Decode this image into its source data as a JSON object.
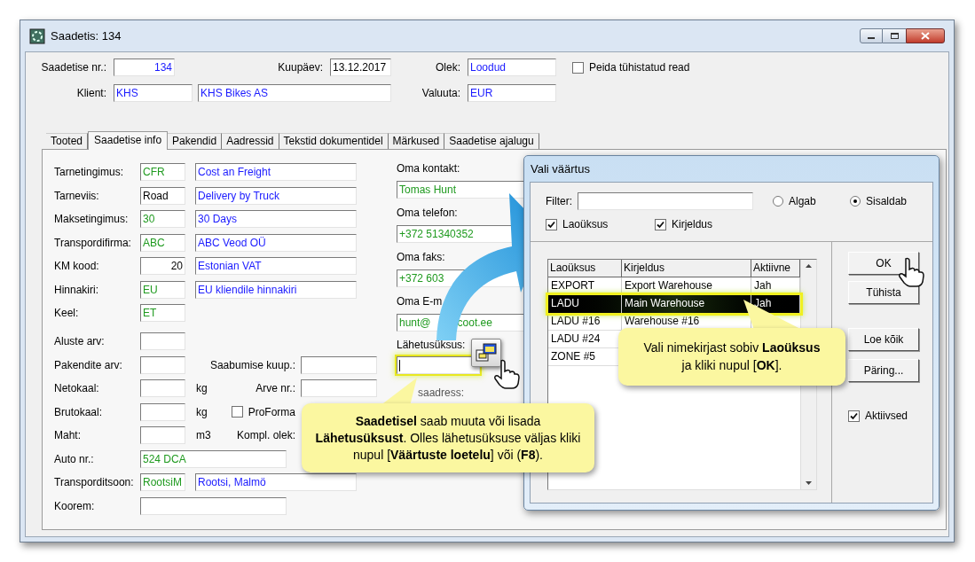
{
  "window": {
    "title": "Saadetis: 134"
  },
  "header": {
    "number_label": "Saadetise nr.:",
    "number": "134",
    "date_label": "Kuupäev:",
    "date": "13.12.2017",
    "status_label": "Olek:",
    "status": "Loodud",
    "hide_cancelled": {
      "label": "Peida tühistatud read",
      "checked": false
    },
    "client_label": "Klient:",
    "client_code": "KHS",
    "client_name": "KHS Bikes AS",
    "currency_label": "Valuuta:",
    "currency": "EUR"
  },
  "tabs": [
    {
      "label": "Tooted",
      "selected": false
    },
    {
      "label": "Saadetise info",
      "selected": true
    },
    {
      "label": "Pakendid",
      "selected": false
    },
    {
      "label": "Aadressid",
      "selected": false
    },
    {
      "label": "Tekstid dokumentidel",
      "selected": false
    },
    {
      "label": "Märkused",
      "selected": false
    },
    {
      "label": "Saadetise ajalugu",
      "selected": false
    }
  ],
  "terms": [
    {
      "label": "Tarnetingimus:",
      "code": {
        "text": "CFR",
        "kind": "code"
      },
      "name": {
        "text": "Cost an Freight",
        "kind": "name"
      }
    },
    {
      "label": "Tarneviis:",
      "code": {
        "text": "Road",
        "kind": "plain"
      },
      "name": {
        "text": "Delivery by Truck",
        "kind": "name"
      }
    },
    {
      "label": "Maksetingimus:",
      "code": {
        "text": "30",
        "kind": "code"
      },
      "name": {
        "text": "30 Days",
        "kind": "name"
      }
    },
    {
      "label": "Transpordifirma:",
      "code": {
        "text": "ABC",
        "kind": "code"
      },
      "name": {
        "text": "ABC Veod OÜ",
        "kind": "name"
      }
    },
    {
      "label": "KM kood:",
      "code": {
        "text": "20",
        "kind": "number"
      },
      "name": {
        "text": "Estonian VAT",
        "kind": "name"
      }
    },
    {
      "label": "Hinnakiri:",
      "code": {
        "text": "EU",
        "kind": "code"
      },
      "name": {
        "text": "EU kliendile hinnakiri",
        "kind": "name"
      }
    },
    {
      "label": "Keel:",
      "code": {
        "text": "ET",
        "kind": "code"
      }
    }
  ],
  "details": [
    {
      "label": "Aluste arv:",
      "kind": "short"
    },
    {
      "label": "Pakendite arv:",
      "kind": "short",
      "extra": {
        "kind": "field",
        "label": "Saabumise kuup.:"
      }
    },
    {
      "label": "Netokaal:",
      "kind": "short",
      "unit": "kg",
      "extra": {
        "kind": "field",
        "label": "Arve nr.:"
      }
    },
    {
      "label": "Brutokaal:",
      "kind": "short",
      "unit": "kg",
      "extra": {
        "kind": "checkbox",
        "label": "ProForma",
        "checked": false
      }
    },
    {
      "label": "Maht:",
      "kind": "short",
      "unit": "m3",
      "extra": {
        "kind": "label",
        "label": "Kompl. olek:"
      }
    },
    {
      "label": "Auto nr.:",
      "kind": "wide",
      "value": {
        "text": "524 DCA",
        "kind": "code"
      }
    },
    {
      "label": "Transporditsoon:",
      "kind": "pair",
      "value": {
        "text": "RootsiM",
        "kind": "code"
      },
      "name": {
        "text": "Rootsi, Malmö",
        "kind": "name"
      }
    },
    {
      "label": "Koorem:",
      "kind": "wide"
    }
  ],
  "contacts": [
    {
      "label": "Oma kontakt:",
      "value": "Tomas Hunt"
    },
    {
      "label": "Oma telefon:",
      "value": "+372 51340352"
    },
    {
      "label": "Oma faks:",
      "value": "+372 603"
    },
    {
      "label": "Oma E-m",
      "value": "hunt@",
      "value_after": "coot.ee"
    }
  ],
  "dispatch_unit": {
    "label": "Lähetusüksus:",
    "highlighted": true
  },
  "dispatch_address_label": "saadress:",
  "dialog": {
    "title": "Vali väärtus",
    "filter_label": "Filter:",
    "match_modes": [
      {
        "label": "Algab",
        "selected": false
      },
      {
        "label": "Sisaldab",
        "selected": true
      }
    ],
    "search_in": [
      {
        "label": "Laoüksus",
        "checked": true
      },
      {
        "label": "Kirjeldus",
        "checked": true
      }
    ],
    "columns": [
      "Laoüksus",
      "Kirjeldus",
      "Aktiivne"
    ],
    "rows": [
      {
        "cells": [
          "EXPORT",
          "Export Warehouse",
          "Jah"
        ],
        "selected": false
      },
      {
        "cells": [
          "LADU",
          "Main Warehouse",
          "Jah"
        ],
        "selected": true
      },
      {
        "cells": [
          "LADU #16",
          "Warehouse #16"
        ],
        "selected": false
      },
      {
        "cells": [
          "LADU #24"
        ],
        "selected": false
      },
      {
        "cells": [
          "ZONE #5"
        ],
        "selected": false
      }
    ],
    "buttons": [
      "OK",
      "Tühista",
      "Loe kõik",
      "Päring..."
    ],
    "active_only": {
      "label": "Aktiivsed",
      "checked": true
    }
  },
  "callouts": [
    "**Saadetisel** saab muuta või lisada **Lähetusüksust**. Olles lähetusüksuse väljas kliki nupul [**Väärtuste loetelu**] või (**F8**).",
    "Vali nimekirjast sobiv **Laoüksus** ja kliki nupul [**OK**]."
  ]
}
